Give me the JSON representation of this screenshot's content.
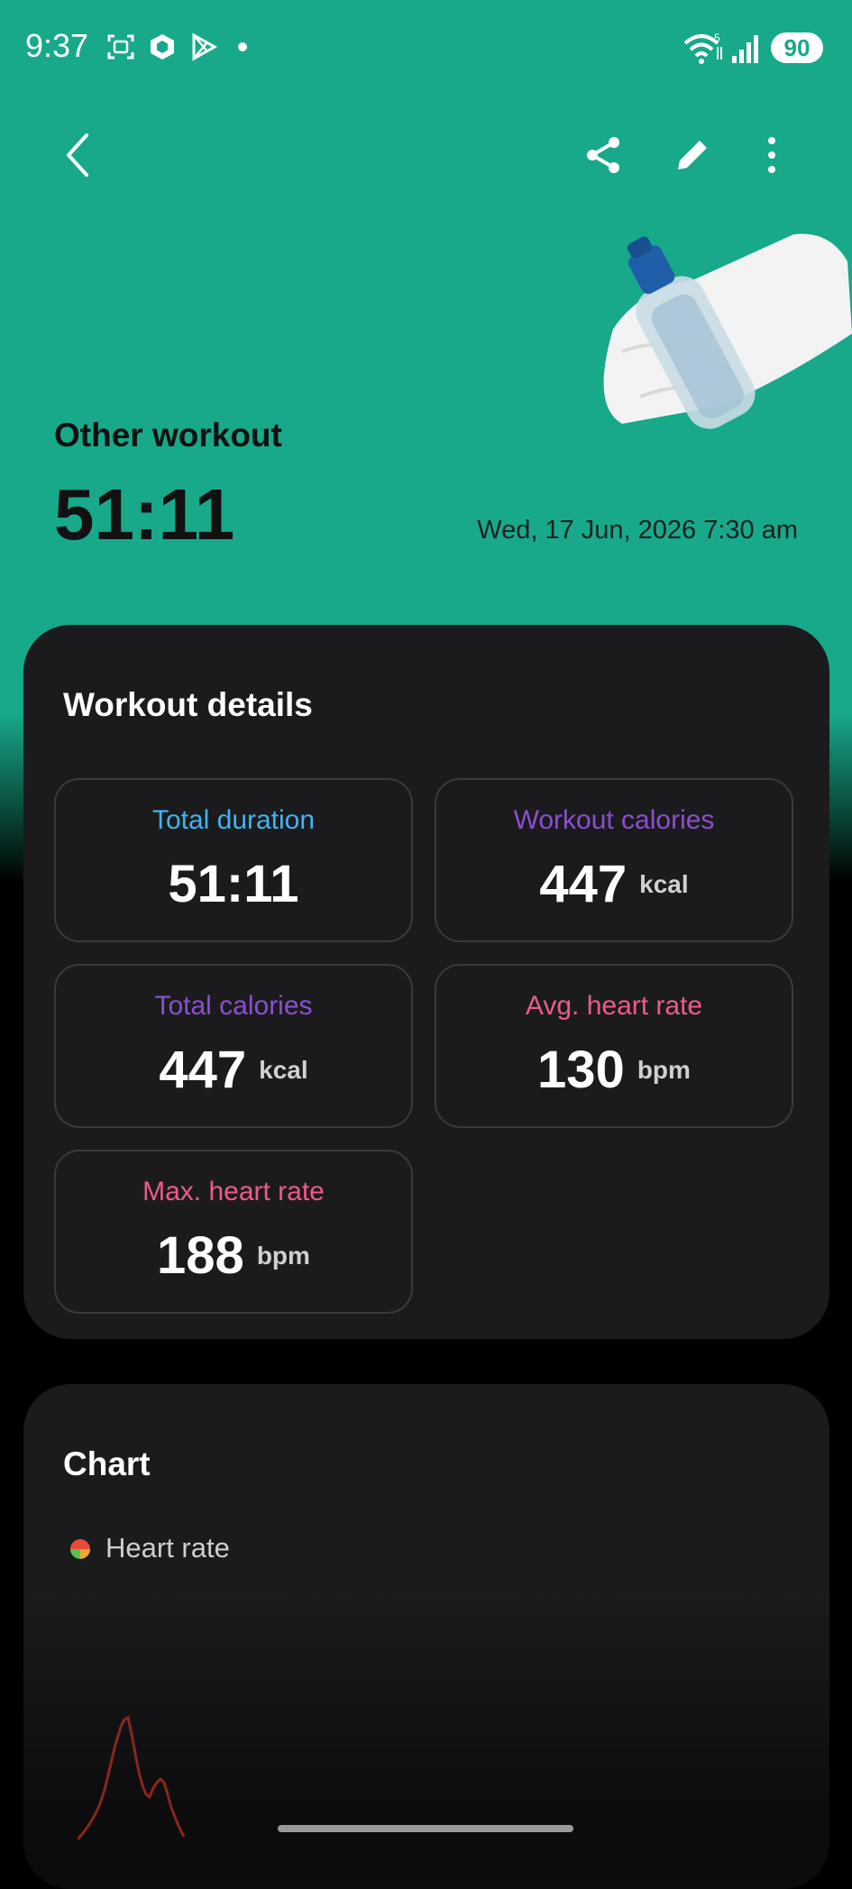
{
  "status_bar": {
    "time": "9:37",
    "battery": "90",
    "icons": [
      "screenshot-icon",
      "hexagon-app-icon",
      "play-icon",
      "dot-icon",
      "wifi-icon",
      "signal-icon",
      "battery-icon"
    ]
  },
  "header": {
    "icons": [
      "back-icon",
      "share-icon",
      "edit-icon",
      "more-icon"
    ],
    "workout_type": "Other workout",
    "duration": "51:11",
    "datetime": "Wed, 17 Jun, 2026 7:30 am"
  },
  "details": {
    "title": "Workout details",
    "tiles": [
      {
        "label": "Total duration",
        "value": "51:11",
        "unit": "",
        "color": "#3fb4f0"
      },
      {
        "label": "Workout calories",
        "value": "447",
        "unit": "kcal",
        "color": "#8a4fd1"
      },
      {
        "label": "Total calories",
        "value": "447",
        "unit": "kcal",
        "color": "#8a4fd1"
      },
      {
        "label": "Avg. heart rate",
        "value": "130",
        "unit": "bpm",
        "color": "#ee5b86"
      },
      {
        "label": "Max. heart rate",
        "value": "188",
        "unit": "bpm",
        "color": "#ee5b86"
      }
    ]
  },
  "chart": {
    "title": "Chart",
    "legend": "Heart rate"
  },
  "colors": {
    "header_bg": "#17a98a",
    "card_bg": "#1b1b1d",
    "tile_border": "#3a3a3c"
  }
}
